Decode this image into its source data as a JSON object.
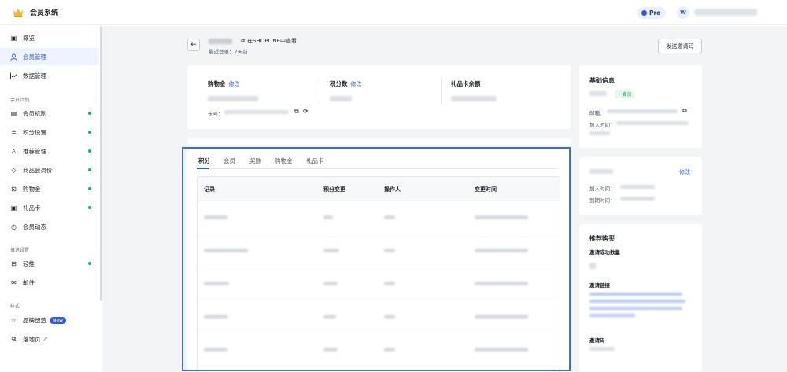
{
  "app": {
    "title": "会员系统"
  },
  "topbar": {
    "plan": "Pro",
    "user_initial": "W"
  },
  "sidebar": {
    "items": [
      {
        "label": "概览",
        "icon": "dashboard-icon",
        "active": false,
        "dot": false
      },
      {
        "label": "会员管理",
        "icon": "user-icon",
        "active": true,
        "dot": false
      },
      {
        "label": "数据管理",
        "icon": "chart-icon",
        "active": false,
        "dot": false
      }
    ],
    "section_plan": "会员计划",
    "plan_items": [
      {
        "label": "会员机制",
        "icon": "doc-icon",
        "dot": true
      },
      {
        "label": "积分设置",
        "icon": "database-icon",
        "dot": true
      },
      {
        "label": "推荐管理",
        "icon": "referral-icon",
        "dot": true
      },
      {
        "label": "商品会员价",
        "icon": "tag-icon",
        "dot": true
      },
      {
        "label": "购物金",
        "icon": "wallet-icon",
        "dot": true
      },
      {
        "label": "礼品卡",
        "icon": "giftcard-icon",
        "dot": true
      },
      {
        "label": "会员动态",
        "icon": "activity-icon",
        "dot": false
      }
    ],
    "section_push": "推送设置",
    "push_items": [
      {
        "label": "轻推",
        "icon": "nudge-icon",
        "dot": true
      },
      {
        "label": "邮件",
        "icon": "mail-icon",
        "dot": false
      }
    ],
    "section_style": "样式",
    "style_items": [
      {
        "label": "品牌塑造",
        "icon": "star-icon",
        "badge": "New"
      },
      {
        "label": "落地页",
        "icon": "page-icon",
        "badge": ""
      }
    ]
  },
  "header": {
    "view_in_shopline": "在SHOPLINE中查看",
    "last_login": "最近登录：7天前",
    "invite_button": "发送邀请码"
  },
  "summary": {
    "shopping_credit_label": "购物金",
    "edit_label": "修改",
    "points_label": "积分数",
    "giftcard_label": "礼品卡余额",
    "card_no_label": "卡号："
  },
  "tabs": [
    "积分",
    "会员",
    "奖励",
    "购物金",
    "礼品卡"
  ],
  "table": {
    "columns": [
      "记录",
      "积分变更",
      "操作人",
      "变更时间"
    ],
    "row_count": 5
  },
  "basic_info": {
    "title": "基础信息",
    "member_tag": "• 会员",
    "email_label": "邮箱：",
    "join_label": "加入时间："
  },
  "membership": {
    "edit_label": "修改",
    "join_label": "加入时间：",
    "expire_label": "到期时间："
  },
  "referral": {
    "title": "推荐购买",
    "invite_count_label": "邀请成功数量",
    "invite_link_label": "邀请链接",
    "invite_code_label": "邀请码"
  }
}
